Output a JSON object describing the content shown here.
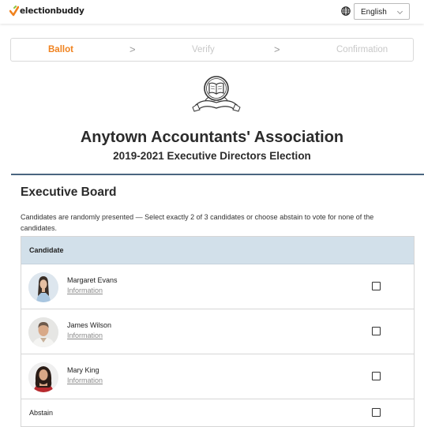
{
  "header": {
    "brand": "electionbuddy",
    "language": {
      "selected": "English"
    },
    "colors": {
      "brand_orange": "#f0821e",
      "brand_green": "#8dc63f"
    }
  },
  "steps": [
    {
      "label": "Ballot",
      "state": "active"
    },
    {
      "label": "Verify",
      "state": "inactive"
    },
    {
      "label": "Confirmation",
      "state": "inactive"
    }
  ],
  "step_separator": ">",
  "organization": {
    "emblem_icon": "open-book-shield-icon",
    "name": "Anytown Accountants' Association",
    "election": "2019-2021 Executive Directors Election"
  },
  "ballot": {
    "section_title": "Executive Board",
    "instructions": "Candidates are randomly presented — Select exactly 2 of 3 candidates or choose abstain to vote for none of the candidates.",
    "table_header": "Candidate",
    "candidates": [
      {
        "name": "Margaret Evans",
        "info_link": "Information"
      },
      {
        "name": "James Wilson",
        "info_link": "Information"
      },
      {
        "name": "Mary King",
        "info_link": "Information"
      }
    ],
    "abstain_label": "Abstain"
  }
}
